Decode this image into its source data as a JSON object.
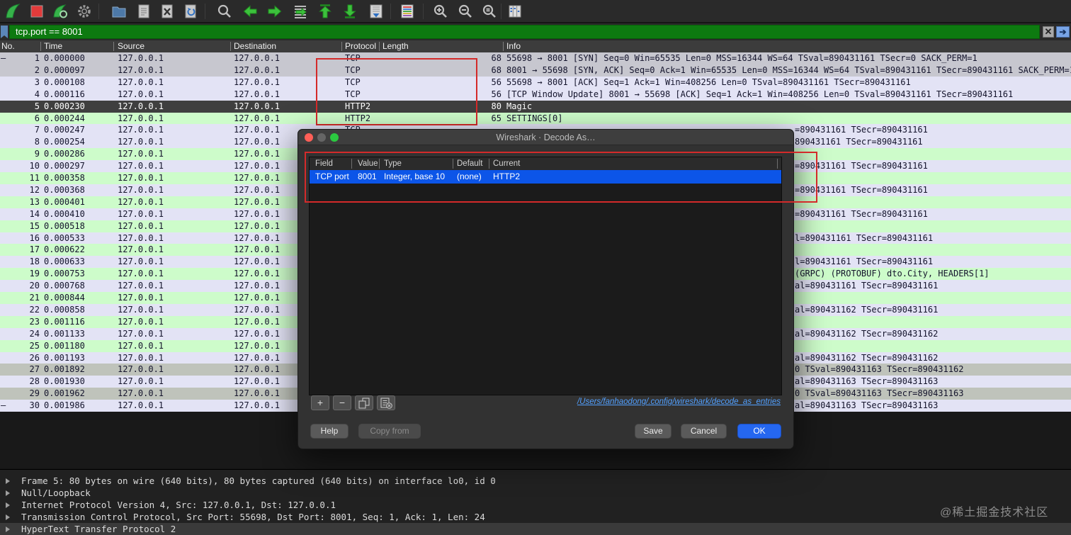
{
  "toolbar": {
    "icons": [
      "wireshark-fin-icon",
      "stop-capture-icon",
      "restart-capture-icon",
      "capture-options-gear-icon",
      "open-file-folder-icon",
      "save-file-icon",
      "close-file-icon",
      "reload-file-icon",
      "find-packet-icon",
      "previous-packet-icon",
      "next-packet-icon",
      "go-to-packet-icon",
      "first-packet-icon",
      "last-packet-icon",
      "auto-scroll-icon",
      "colorize-icon",
      "zoom-in-icon",
      "zoom-out-icon",
      "zoom-reset-icon",
      "resize-columns-icon"
    ]
  },
  "filter": {
    "value": "tcp.port == 8001",
    "clear_label": "✕",
    "apply_label": "➔"
  },
  "packet_list": {
    "columns": [
      "No.",
      "Time",
      "Source",
      "Destination",
      "Protocol",
      "Length",
      "Info"
    ],
    "rows": [
      {
        "marker": "—",
        "no": "1",
        "time": "0.000000",
        "src": "127.0.0.1",
        "dst": "127.0.0.1",
        "proto": "TCP",
        "len": "68",
        "info": "55698 → 8001 [SYN] Seq=0 Win=65535 Len=0 MSS=16344 WS=64 TSval=890431161 TSecr=0 SACK_PERM=1",
        "frag": "",
        "bg": "gray"
      },
      {
        "marker": "",
        "no": "2",
        "time": "0.000097",
        "src": "127.0.0.1",
        "dst": "127.0.0.1",
        "proto": "TCP",
        "len": "68",
        "info": "8001 → 55698 [SYN, ACK] Seq=0 Ack=1 Win=65535 Len=0 MSS=16344 WS=64 TSval=890431161 TSecr=890431161 SACK_PERM=1",
        "frag": "",
        "bg": "gray"
      },
      {
        "marker": "",
        "no": "3",
        "time": "0.000108",
        "src": "127.0.0.1",
        "dst": "127.0.0.1",
        "proto": "TCP",
        "len": "56",
        "info": "55698 → 8001 [ACK] Seq=1 Ack=1 Win=408256 Len=0 TSval=890431161 TSecr=890431161",
        "frag": "",
        "bg": "lav"
      },
      {
        "marker": "",
        "no": "4",
        "time": "0.000116",
        "src": "127.0.0.1",
        "dst": "127.0.0.1",
        "proto": "TCP",
        "len": "56",
        "info": "[TCP Window Update] 8001 → 55698 [ACK] Seq=1 Ack=1 Win=408256 Len=0 TSval=890431161 TSecr=890431161",
        "frag": "",
        "bg": "lav"
      },
      {
        "marker": "",
        "no": "5",
        "time": "0.000230",
        "src": "127.0.0.1",
        "dst": "127.0.0.1",
        "proto": "HTTP2",
        "len": "80",
        "info": "Magic",
        "frag": "",
        "bg": "sel"
      },
      {
        "marker": "",
        "no": "6",
        "time": "0.000244",
        "src": "127.0.0.1",
        "dst": "127.0.0.1",
        "proto": "HTTP2",
        "len": "65",
        "info": "SETTINGS[0]",
        "frag": "",
        "bg": "green"
      },
      {
        "marker": "",
        "no": "7",
        "time": "0.000247",
        "src": "127.0.0.1",
        "dst": "127.0.0.1",
        "proto": "TCP",
        "len": "",
        "info": "",
        "frag": "=890431161 TSecr=890431161",
        "bg": "lav"
      },
      {
        "marker": "",
        "no": "8",
        "time": "0.000254",
        "src": "127.0.0.1",
        "dst": "127.0.0.1",
        "proto": "",
        "len": "",
        "info": "",
        "frag": "890431161 TSecr=890431161",
        "bg": "lav"
      },
      {
        "marker": "",
        "no": "9",
        "time": "0.000286",
        "src": "127.0.0.1",
        "dst": "127.0.0.1",
        "proto": "",
        "len": "",
        "info": "",
        "frag": "",
        "bg": "green"
      },
      {
        "marker": "",
        "no": "10",
        "time": "0.000297",
        "src": "127.0.0.1",
        "dst": "127.0.0.1",
        "proto": "",
        "len": "",
        "info": "",
        "frag": "=890431161 TSecr=890431161",
        "bg": "lav"
      },
      {
        "marker": "",
        "no": "11",
        "time": "0.000358",
        "src": "127.0.0.1",
        "dst": "127.0.0.1",
        "proto": "",
        "len": "",
        "info": "",
        "frag": "",
        "bg": "green"
      },
      {
        "marker": "",
        "no": "12",
        "time": "0.000368",
        "src": "127.0.0.1",
        "dst": "127.0.0.1",
        "proto": "",
        "len": "",
        "info": "",
        "frag": "=890431161 TSecr=890431161",
        "bg": "lav"
      },
      {
        "marker": "",
        "no": "13",
        "time": "0.000401",
        "src": "127.0.0.1",
        "dst": "127.0.0.1",
        "proto": "",
        "len": "",
        "info": "",
        "frag": "",
        "bg": "green"
      },
      {
        "marker": "",
        "no": "14",
        "time": "0.000410",
        "src": "127.0.0.1",
        "dst": "127.0.0.1",
        "proto": "",
        "len": "",
        "info": "",
        "frag": "=890431161 TSecr=890431161",
        "bg": "lav"
      },
      {
        "marker": "",
        "no": "15",
        "time": "0.000518",
        "src": "127.0.0.1",
        "dst": "127.0.0.1",
        "proto": "",
        "len": "",
        "info": "",
        "frag": "",
        "bg": "green"
      },
      {
        "marker": "",
        "no": "16",
        "time": "0.000533",
        "src": "127.0.0.1",
        "dst": "127.0.0.1",
        "proto": "",
        "len": "",
        "info": "",
        "frag": "l=890431161 TSecr=890431161",
        "bg": "lav"
      },
      {
        "marker": "",
        "no": "17",
        "time": "0.000622",
        "src": "127.0.0.1",
        "dst": "127.0.0.1",
        "proto": "",
        "len": "",
        "info": "",
        "frag": "",
        "bg": "green"
      },
      {
        "marker": "",
        "no": "18",
        "time": "0.000633",
        "src": "127.0.0.1",
        "dst": "127.0.0.1",
        "proto": "",
        "len": "",
        "info": "",
        "frag": "l=890431161 TSecr=890431161",
        "bg": "lav"
      },
      {
        "marker": "",
        "no": "19",
        "time": "0.000753",
        "src": "127.0.0.1",
        "dst": "127.0.0.1",
        "proto": "",
        "len": "",
        "info": "",
        "frag": "(GRPC) (PROTOBUF) dto.City, HEADERS[1]",
        "bg": "green"
      },
      {
        "marker": "",
        "no": "20",
        "time": "0.000768",
        "src": "127.0.0.1",
        "dst": "127.0.0.1",
        "proto": "",
        "len": "",
        "info": "",
        "frag": "al=890431161 TSecr=890431161",
        "bg": "lav"
      },
      {
        "marker": "",
        "no": "21",
        "time": "0.000844",
        "src": "127.0.0.1",
        "dst": "127.0.0.1",
        "proto": "",
        "len": "",
        "info": "",
        "frag": "",
        "bg": "green"
      },
      {
        "marker": "",
        "no": "22",
        "time": "0.000858",
        "src": "127.0.0.1",
        "dst": "127.0.0.1",
        "proto": "",
        "len": "",
        "info": "",
        "frag": "al=890431162 TSecr=890431161",
        "bg": "lav"
      },
      {
        "marker": "",
        "no": "23",
        "time": "0.001116",
        "src": "127.0.0.1",
        "dst": "127.0.0.1",
        "proto": "",
        "len": "",
        "info": "",
        "frag": "",
        "bg": "green"
      },
      {
        "marker": "",
        "no": "24",
        "time": "0.001133",
        "src": "127.0.0.1",
        "dst": "127.0.0.1",
        "proto": "",
        "len": "",
        "info": "",
        "frag": "al=890431162 TSecr=890431162",
        "bg": "lav"
      },
      {
        "marker": "",
        "no": "25",
        "time": "0.001180",
        "src": "127.0.0.1",
        "dst": "127.0.0.1",
        "proto": "",
        "len": "",
        "info": "",
        "frag": "",
        "bg": "green"
      },
      {
        "marker": "",
        "no": "26",
        "time": "0.001193",
        "src": "127.0.0.1",
        "dst": "127.0.0.1",
        "proto": "",
        "len": "",
        "info": "",
        "frag": "al=890431162 TSecr=890431162",
        "bg": "lav"
      },
      {
        "marker": "",
        "no": "27",
        "time": "0.001892",
        "src": "127.0.0.1",
        "dst": "127.0.0.1",
        "proto": "",
        "len": "",
        "info": "",
        "frag": "0 TSval=890431163 TSecr=890431162",
        "bg": "gray2"
      },
      {
        "marker": "",
        "no": "28",
        "time": "0.001930",
        "src": "127.0.0.1",
        "dst": "127.0.0.1",
        "proto": "",
        "len": "",
        "info": "",
        "frag": "al=890431163 TSecr=890431163",
        "bg": "lav"
      },
      {
        "marker": "",
        "no": "29",
        "time": "0.001962",
        "src": "127.0.0.1",
        "dst": "127.0.0.1",
        "proto": "",
        "len": "",
        "info": "",
        "frag": "0 TSval=890431163 TSecr=890431163",
        "bg": "gray2"
      },
      {
        "marker": "—",
        "no": "30",
        "time": "0.001986",
        "src": "127.0.0.1",
        "dst": "127.0.0.1",
        "proto": "",
        "len": "",
        "info": "",
        "frag": "al=890431163 TSecr=890431163",
        "bg": "lav"
      }
    ]
  },
  "dialog": {
    "title": "Wireshark · Decode As…",
    "table": {
      "columns": [
        "Field",
        "Value",
        "Type",
        "Default",
        "Current"
      ],
      "row": [
        "TCP port",
        "8001",
        "Integer, base 10",
        "(none)",
        "HTTP2"
      ]
    },
    "small_buttons": [
      {
        "name": "add-entry-button",
        "label": "+"
      },
      {
        "name": "remove-entry-button",
        "label": "−"
      },
      {
        "name": "copy-entry-button",
        "icon": "copy-icon"
      },
      {
        "name": "clear-entries-button",
        "icon": "clear-list-icon"
      }
    ],
    "entries_path": "/Users/fanhaodong/.config/wireshark/decode_as_entries",
    "buttons": {
      "help": "Help",
      "copy_from": "Copy from",
      "save": "Save",
      "cancel": "Cancel",
      "ok": "OK"
    }
  },
  "details": {
    "lines": [
      "Frame 5: 80 bytes on wire (640 bits), 80 bytes captured (640 bits) on interface lo0, id 0",
      "Null/Loopback",
      "Internet Protocol Version 4, Src: 127.0.0.1, Dst: 127.0.0.1",
      "Transmission Control Protocol, Src Port: 55698, Dst Port: 8001, Seq: 1, Ack: 1, Len: 24",
      "HyperText Transfer Protocol 2"
    ],
    "selected_index": 4
  },
  "watermark": "@稀土掘金技术社区",
  "colors": {
    "row_green": "#cdfcca",
    "row_lavender": "#e3e3f5",
    "row_gray": "#c7c7cf",
    "row_gray_warm": "#bfc3bb",
    "selected_row_dark": "#3f3f3f",
    "dialog_selection_blue": "#0c55e8",
    "filter_green": "#0d7a10",
    "annotation_red": "#d42a2a",
    "link_blue": "#52a0ff",
    "ok_button_blue": "#2567f0"
  }
}
